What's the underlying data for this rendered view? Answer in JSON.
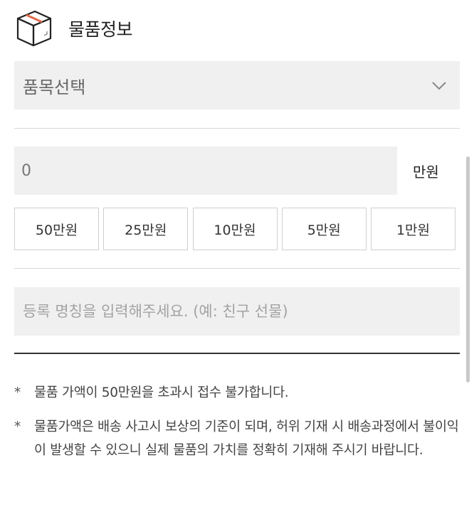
{
  "header": {
    "title": "물품정보",
    "icon": "package-box-icon"
  },
  "item_select": {
    "label": "품목선택",
    "icon": "chevron-down-icon"
  },
  "amount": {
    "value": "0",
    "unit": "만원"
  },
  "presets": [
    {
      "label": "50만원"
    },
    {
      "label": "25만원"
    },
    {
      "label": "10만원"
    },
    {
      "label": "5만원"
    },
    {
      "label": "1만원"
    }
  ],
  "name_field": {
    "placeholder": "등록 명칭을 입력해주세요. (예: 친구 선물)"
  },
  "notes": [
    {
      "bullet": "*",
      "text": "물품 가액이 50만원을 초과시 접수 불가합니다."
    },
    {
      "bullet": "*",
      "text": "물품가액은 배송 사고시 보상의 기준이 되며, 허위 기재 시 배송과정에서 불이익이 발생할 수 있으니 실제 물품의 가치를 정확히 기재해 주시기 바랍니다."
    }
  ],
  "colors": {
    "field_bg": "#f0f0f0",
    "divider": "#d8d8d8",
    "accent_line": "#e0694a"
  }
}
